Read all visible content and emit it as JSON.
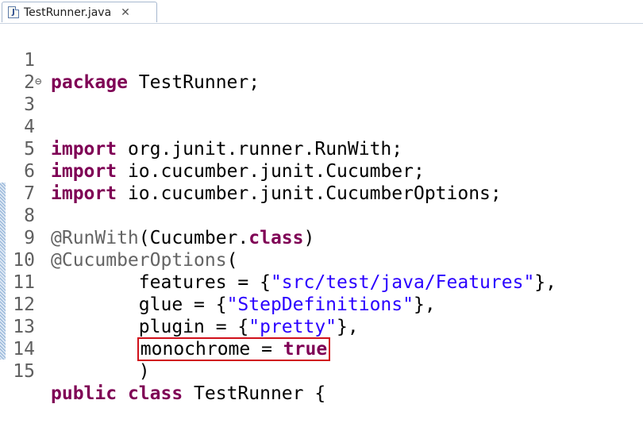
{
  "tab": {
    "file_name": "TestRunner.java",
    "icon": "J",
    "close_glyph": "✕"
  },
  "editor": {
    "fold_glyph": "⊖",
    "lines": [
      {
        "n": "1"
      },
      {
        "n": "2"
      },
      {
        "n": "3"
      },
      {
        "n": "4"
      },
      {
        "n": "5"
      },
      {
        "n": "6"
      },
      {
        "n": "7"
      },
      {
        "n": "8"
      },
      {
        "n": "9"
      },
      {
        "n": "10"
      },
      {
        "n": "11"
      },
      {
        "n": "12"
      },
      {
        "n": "13"
      },
      {
        "n": "14"
      },
      {
        "n": "15"
      }
    ],
    "tokens": {
      "package_kw": "package",
      "package_name": " TestRunner;",
      "import_kw": "import",
      "import_runwith": " org.junit.runner.RunWith;",
      "import_cucumber": " io.cucumber.junit.Cucumber;",
      "import_options": " io.cucumber.junit.CucumberOptions;",
      "runwith_ann": "@RunWith",
      "runwith_open": "(Cucumber.",
      "class_kw": "class",
      "runwith_close": ")",
      "options_ann": "@CucumberOptions",
      "options_open": "(",
      "features_pre": "        features = {",
      "features_str": "\"src/test/java/Features\"",
      "features_post": "},",
      "glue_pre": "        glue = {",
      "glue_str": "\"StepDefinitions\"",
      "glue_post": "},",
      "plugin_pre": "        plugin = {",
      "plugin_str": "\"pretty\"",
      "plugin_post": "},",
      "indent": "        ",
      "monochrome_pre": "monochrome = ",
      "true_kw": "true",
      "close_paren": "        )",
      "public_kw": "public",
      "class_kw2": " class",
      "class_name": " TestRunner {"
    }
  },
  "colors": {
    "keyword": "#7f0055",
    "string": "#2a00ff",
    "annotation": "#646464",
    "highlight_box": "#d0101a"
  }
}
